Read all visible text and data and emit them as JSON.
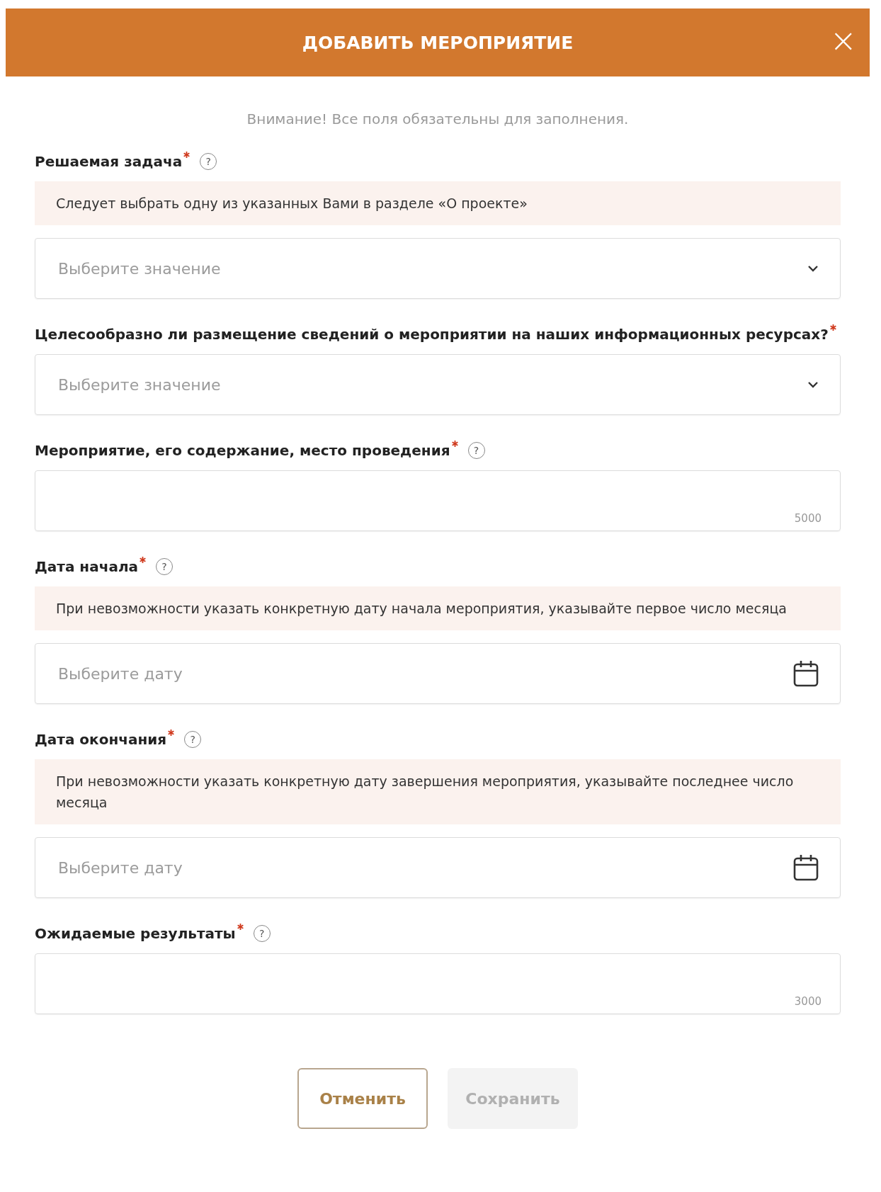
{
  "dialog": {
    "title": "ДОБАВИТЬ МЕРОПРИЯТИЕ",
    "close": "×"
  },
  "notice": "Внимание! Все поля обязательны для заполнения.",
  "fields": [
    {
      "kind": "select",
      "label": "Решаемая задача",
      "required": true,
      "help": "?",
      "hint": "Следует выбрать одну из указанных Вами в разделе «О проекте»",
      "placeholder": "Выберите значение"
    },
    {
      "kind": "select",
      "label": "Целесообразно ли размещение сведений о мероприятии на наших информационных ресурсах?",
      "required": true,
      "placeholder": "Выберите значение"
    },
    {
      "kind": "textarea",
      "label": "Мероприятие, его содержание, место проведения",
      "required": true,
      "help": "?",
      "counter": "5000"
    },
    {
      "kind": "date",
      "label": "Дата начала",
      "required": true,
      "help": "?",
      "hint": "При невозможности указать конкретную дату начала мероприятия, указывайте первое число месяца",
      "placeholder": "Выберите дату"
    },
    {
      "kind": "date",
      "label": "Дата окончания",
      "required": true,
      "help": "?",
      "hint": "При невозможности указать конкретную дату завершения мероприятия, указывайте последнее число месяца",
      "placeholder": "Выберите дату"
    },
    {
      "kind": "textarea",
      "label": "Ожидаемые результаты",
      "required": true,
      "help": "?",
      "counter": "3000"
    }
  ],
  "buttons": [
    {
      "label": "Отменить",
      "disabled": false
    },
    {
      "label": "Сохранить",
      "disabled": true
    }
  ]
}
